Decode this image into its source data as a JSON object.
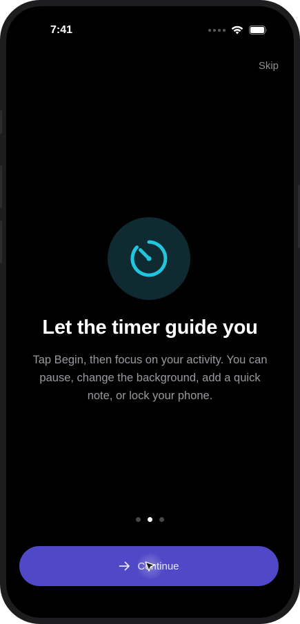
{
  "status_bar": {
    "time": "7:41"
  },
  "onboarding": {
    "skip_label": "Skip",
    "icon": "timer-icon",
    "title": "Let the timer guide you",
    "description": "Tap Begin, then focus on your activity. You can pause, change the background, add a quick note, or lock your phone.",
    "page_count": 3,
    "current_page": 2,
    "continue_label": "Continue",
    "continue_icon": "arrow-right-icon"
  },
  "colors": {
    "accent_button": "#5049c7",
    "icon_teal": "#22c5dd",
    "icon_background": "#0f2a30"
  }
}
